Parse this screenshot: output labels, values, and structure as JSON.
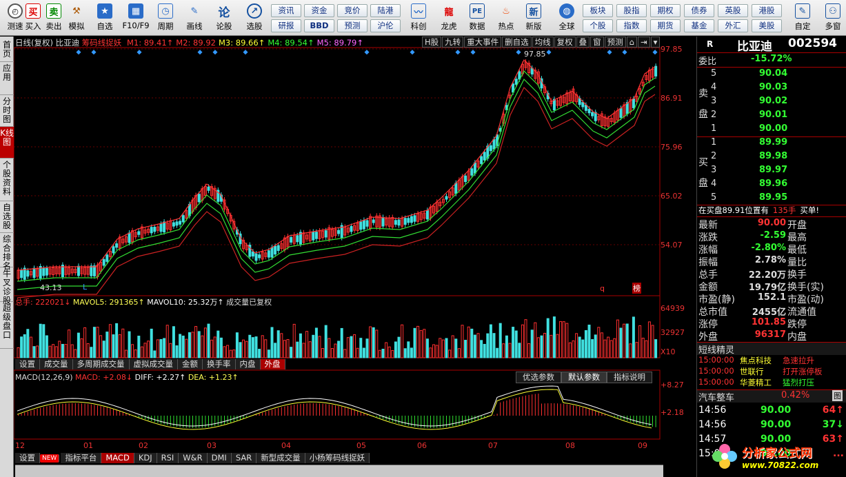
{
  "toolbar": {
    "icons": [
      {
        "label": "测速",
        "name": "speedtest-icon"
      },
      {
        "label": "买入",
        "name": "buy-icon"
      },
      {
        "label": "卖出",
        "name": "sell-icon"
      },
      {
        "label": "模拟",
        "name": "simulate-icon"
      },
      {
        "label": "自选",
        "name": "watchlist-icon"
      },
      {
        "label": "F10/F9",
        "name": "f10-icon"
      },
      {
        "label": "周期",
        "name": "period-icon"
      },
      {
        "label": "画线",
        "name": "draw-line-icon"
      },
      {
        "label": "论股",
        "name": "discuss-icon"
      },
      {
        "label": "选股",
        "name": "stock-pick-icon"
      }
    ],
    "grid1": [
      [
        "资讯",
        "资金",
        "竞价",
        "陆港"
      ],
      [
        "研报",
        "BBD",
        "预测",
        "沪伦"
      ]
    ],
    "icons2": [
      {
        "label": "科创",
        "name": "star-market-icon"
      },
      {
        "label": "龙虎",
        "name": "dragon-tiger-icon"
      },
      {
        "label": "数据",
        "name": "data-icon"
      },
      {
        "label": "热点",
        "name": "hotspot-icon"
      },
      {
        "label": "新版",
        "name": "new-version-icon"
      },
      {
        "label": "全球",
        "name": "globe-icon"
      }
    ],
    "grid2": [
      [
        "板块",
        "股指",
        "期权",
        "债券",
        "英股",
        "港股"
      ],
      [
        "个股",
        "指数",
        "期货",
        "基金",
        "外汇",
        "美股"
      ]
    ],
    "icons3": [
      {
        "label": "自定",
        "name": "customize-icon"
      },
      {
        "label": "多窗",
        "name": "multi-window-icon"
      }
    ],
    "buy_text": "买",
    "sell_text": "卖",
    "discuss_text": "论",
    "pe_text": "PE",
    "new_text": "新"
  },
  "lefttabs": [
    "首页",
    "应用",
    "分时图",
    "K线图",
    "个股资料",
    "自选股",
    "综合排名",
    "牛叉诊股",
    "超级盘口"
  ],
  "chart": {
    "period": "日线(复权)",
    "stock": "比亚迪",
    "indicator": "筹码线捉妖",
    "ma": [
      {
        "label": "M1: 89.41↑",
        "color": "#ff3333"
      },
      {
        "label": "M2: 89.92",
        "color": "#ff3333"
      },
      {
        "label": "M3: 89.66↑",
        "color": "#ffff33"
      },
      {
        "label": "M4: 89.54↑",
        "color": "#33ff33"
      },
      {
        "label": "M5: 89.79↑",
        "color": "#ff66ff"
      }
    ],
    "tools": [
      "H股",
      "九转",
      "重大事件",
      "删自选",
      "均线",
      "复权",
      "叠",
      "窗",
      "预测"
    ],
    "axis": [
      "97.85",
      "86.91",
      "75.96",
      "65.02",
      "54.07",
      "43.13"
    ],
    "high_label": "97.85",
    "low_label": "43.13",
    "marks": [
      "L",
      "q",
      "榜"
    ]
  },
  "volume": {
    "total": "总手: 222021↓",
    "mavol5": "MAVOL5: 291365↑",
    "mavol10": "MAVOL10: 25.32万↑",
    "note": "成交量已复权",
    "axis": [
      "64939",
      "32927",
      "X10"
    ]
  },
  "vol_tabs": [
    "设置",
    "成交量",
    "多周期成交量",
    "虚拟成交量",
    "金额",
    "换手率",
    "内盘",
    "外盘"
  ],
  "macd": {
    "title": "MACD(12,26,9)",
    "macd": "MACD: +2.08↓",
    "diff": "DIFF: +2.27↑",
    "dea": "DEA: +1.23↑",
    "buttons": [
      "优选参数",
      "默认参数",
      "指标说明"
    ],
    "axis": [
      "+8.27",
      "+2.18"
    ]
  },
  "months": [
    "12",
    "01",
    "02",
    "03",
    "04",
    "05",
    "06",
    "07",
    "08",
    "09"
  ],
  "bottom_tabs": [
    "设置",
    "NEW",
    "指标平台",
    "MACD",
    "KDJ",
    "RSI",
    "W&R",
    "DMI",
    "SAR",
    "新型成交量",
    "小杨筹码线捉妖"
  ],
  "quote": {
    "r": "R",
    "name": "比亚迪",
    "code": "002594",
    "webi_label": "委比",
    "webi": "-15.72%",
    "sell_label": "卖盘",
    "buy_label": "买盘",
    "sells": [
      {
        "n": "5",
        "p": "90.04"
      },
      {
        "n": "4",
        "p": "90.03"
      },
      {
        "n": "3",
        "p": "90.02"
      },
      {
        "n": "2",
        "p": "90.01"
      },
      {
        "n": "1",
        "p": "90.00"
      }
    ],
    "buys": [
      {
        "n": "1",
        "p": "89.99"
      },
      {
        "n": "2",
        "p": "89.98"
      },
      {
        "n": "3",
        "p": "89.97"
      },
      {
        "n": "4",
        "p": "89.96"
      },
      {
        "n": "5",
        "p": "89.95"
      }
    ],
    "notice_a": "在买盘89.91位置有",
    "notice_b": "135手",
    "notice_c": "买单!",
    "stats": [
      {
        "l": "最新",
        "v": "90.00",
        "r": "开盘"
      },
      {
        "l": "涨跌",
        "v": "-2.59",
        "r": "最高"
      },
      {
        "l": "涨幅",
        "v": "-2.80%",
        "r": "最低"
      },
      {
        "l": "振幅",
        "v": "2.78%",
        "r": "量比"
      },
      {
        "l": "总手",
        "v": "22.20万",
        "r": "换手"
      },
      {
        "l": "金额",
        "v": "19.79亿",
        "r": "换手(实)"
      },
      {
        "l": "市盈(静)",
        "v": "152.1",
        "r": "市盈(动)"
      },
      {
        "l": "总市值",
        "v": "2455亿",
        "r": "流通值"
      },
      {
        "l": "涨停",
        "v": "101.85",
        "r": "跌停"
      },
      {
        "l": "外盘",
        "v": "96317",
        "r": "内盘"
      }
    ],
    "spirit_title": "短线精灵",
    "spirit": [
      {
        "t": "15:00:00",
        "s": "焦点科技",
        "e": "急速拉升"
      },
      {
        "t": "15:00:00",
        "s": "世联行",
        "e": "打开涨停板"
      },
      {
        "t": "15:00:00",
        "s": "华菱精工",
        "e": "猛烈打压"
      }
    ],
    "sector": "汽车整车",
    "sector_pct": "0.42%",
    "sector_btn": "图",
    "ticks": [
      {
        "t": "14:56",
        "p": "90.00",
        "v": "64↑"
      },
      {
        "t": "14:56",
        "p": "90.00",
        "v": "37↓"
      },
      {
        "t": "14:57",
        "p": "90.00",
        "v": "63↑"
      },
      {
        "t": "15:00",
        "p": "90.00",
        "v": "..."
      }
    ]
  },
  "watermark": {
    "text": "分析家公式网",
    "url": "www.70822.com"
  }
}
